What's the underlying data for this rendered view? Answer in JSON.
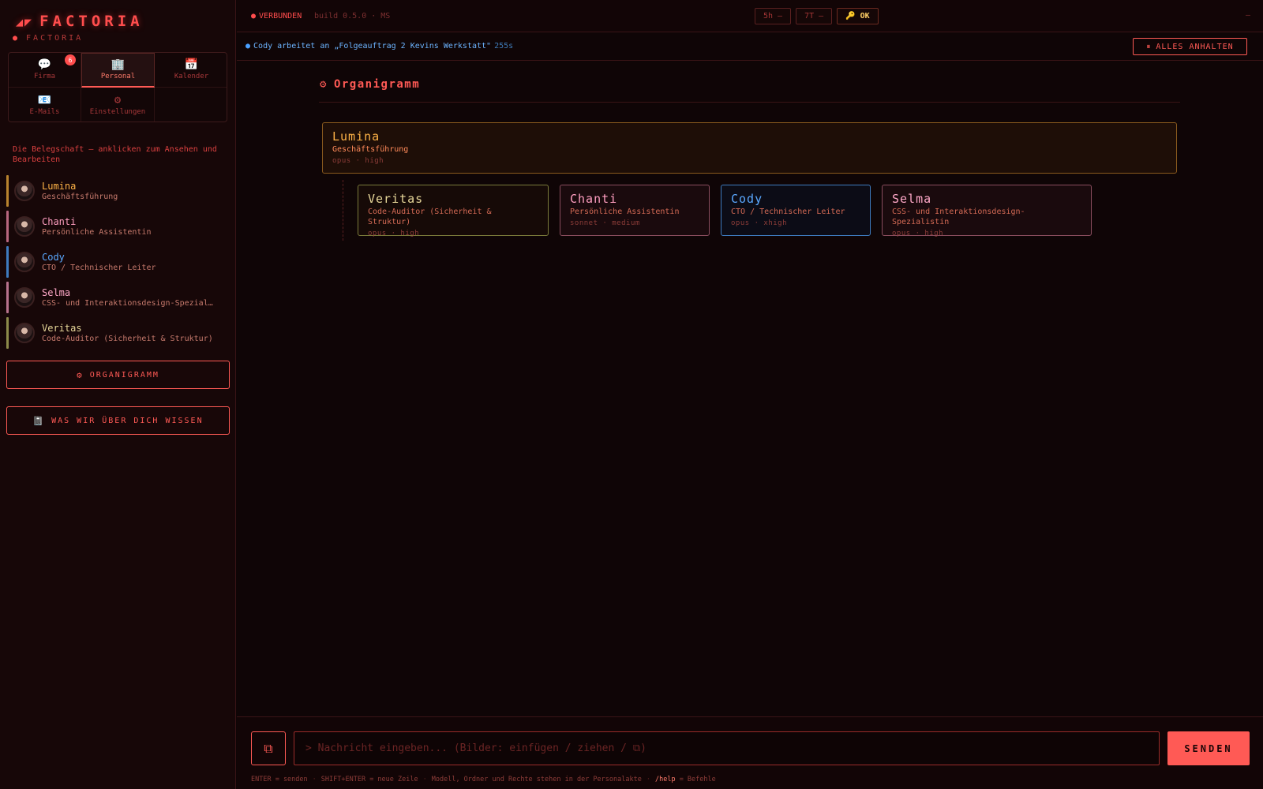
{
  "brand": {
    "logo_mark": "◢◤",
    "title": "FACTORIA",
    "subtitle": "FACTORIA"
  },
  "nav": [
    {
      "icon": "💬",
      "label": "Firma",
      "badge": "6",
      "active": false
    },
    {
      "icon": "🏢",
      "label": "Personal",
      "active": true
    },
    {
      "icon": "📅",
      "label": "Kalender",
      "active": false
    },
    {
      "icon": "📧",
      "label": "E-Mails",
      "active": false
    },
    {
      "icon": "⚙",
      "label": "Einstellungen",
      "active": false
    }
  ],
  "staff_hint": "Die Belegschaft — anklicken zum Ansehen und Bearbeiten",
  "staff": [
    {
      "name": "Lumina",
      "role": "Geschäftsführung",
      "color": "#ffb347"
    },
    {
      "name": "Chanti",
      "role": "Persönliche Assistentin",
      "color": "#ff9ec0"
    },
    {
      "name": "Cody",
      "role": "CTO / Technischer Leiter",
      "color": "#5aa8ff"
    },
    {
      "name": "Selma",
      "role": "CSS- und Interaktionsdesign-Speziali…",
      "color": "#ffa8c8"
    },
    {
      "name": "Veritas",
      "role": "Code-Auditor (Sicherheit & Struktur)",
      "color": "#e8d89a"
    }
  ],
  "sidebar_buttons": {
    "org": {
      "icon": "⚙",
      "label": "ORGANIGRAMM"
    },
    "knowledge": {
      "icon": "📓",
      "label": "WAS WIR ÜBER DICH WISSEN"
    }
  },
  "topbar": {
    "status_dot": "●",
    "status": "VERBUNDEN",
    "build": "build 0.5.0 · MS",
    "pill_5h": "5h –",
    "pill_7t": "7T –",
    "key_icon": "🔑",
    "ok": "OK",
    "right": "–"
  },
  "activity": {
    "dot": "●",
    "text": "Cody arbeitet an „Folgeauftrag 2 Kevins Werkstatt\"",
    "time": "255s",
    "pause_icon": "⏸",
    "pause_label": "ALLES ANHALTEN"
  },
  "org": {
    "icon": "⚙",
    "title": "Organigramm",
    "root": {
      "name": "Lumina",
      "role": "Geschäftsführung",
      "meta": "opus · high"
    },
    "children": [
      {
        "name": "Veritas",
        "role": "Code-Auditor (Sicherheit & Struktur)",
        "meta": "opus · high"
      },
      {
        "name": "Chanti",
        "role": "Persönliche Assistentin",
        "meta": "sonnet · medium"
      },
      {
        "name": "Cody",
        "role": "CTO / Technischer Leiter",
        "meta": "opus · xhigh"
      },
      {
        "name": "Selma",
        "role": "CSS- und Interaktionsdesign-Spezialistin",
        "meta": "opus · high"
      }
    ]
  },
  "composer": {
    "attach_icon": "⧉",
    "placeholder": "> Nachricht eingeben... (Bilder: einfügen / ziehen / ⧉)",
    "value": "",
    "send_label": "SENDEN",
    "hint_enter": "ENTER = senden",
    "hint_shift": "SHIFT+ENTER = neue Zeile",
    "hint_info": "Modell, Ordner und Rechte stehen in der Personalakte",
    "hint_cmd": "/help",
    "hint_cmd_desc": "= Befehle"
  }
}
